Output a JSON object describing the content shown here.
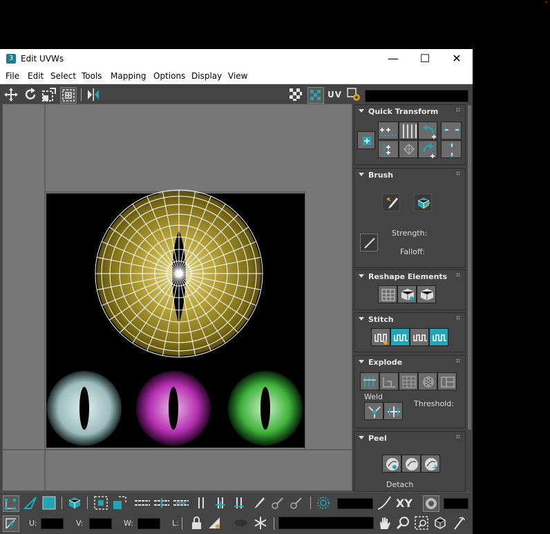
{
  "window": {
    "title": "Edit UVWs",
    "app_icon": "3",
    "minimize": "—",
    "maximize": "☐",
    "close": "✕"
  },
  "menu": [
    "File",
    "Edit",
    "Select",
    "Tools",
    "Mapping",
    "Options",
    "Display",
    "View"
  ],
  "toolbar": {
    "uv_label": "UV",
    "uv_field_value": ""
  },
  "panel": {
    "quick_transform": {
      "title": "Quick Transform"
    },
    "brush": {
      "title": "Brush",
      "strength_label": "Strength:",
      "falloff_label": "Falloff:"
    },
    "reshape": {
      "title": "Reshape Elements"
    },
    "stitch": {
      "title": "Stitch"
    },
    "explode": {
      "title": "Explode",
      "weld_label": "Weld",
      "threshold_label": "Threshold:"
    },
    "peel": {
      "title": "Peel",
      "detach_label": "Detach"
    }
  },
  "bottom": {
    "xy_label": "XY",
    "u_label": "U:",
    "v_label": "V:",
    "w_label": "W:",
    "l_label": "L:",
    "u_value": "",
    "v_value": "",
    "w_value": "",
    "l_value": ""
  },
  "colors": {
    "accent": "#23a5b5",
    "uv_wire": "#ffffff",
    "iris_main": "#8a7a1c",
    "iris_left": "#a9c7c8",
    "iris_mid": "#b62fb1",
    "iris_right": "#3fb23b"
  },
  "icons": [
    "move-icon",
    "rotate-icon",
    "scale-icon",
    "freeform-icon",
    "mirror-icon",
    "checker-icon",
    "uv-icon",
    "settings-icon",
    "snap-icon",
    "pan-icon",
    "zoom-icon",
    "zoom-region-icon",
    "frame-icon",
    "help-icon",
    "lock-icon",
    "snowflake-icon",
    "eye-icon"
  ]
}
